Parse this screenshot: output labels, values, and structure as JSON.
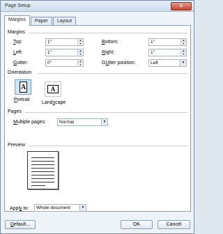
{
  "window": {
    "title": "Page Setup",
    "close_symbol": "✕"
  },
  "tabs": [
    {
      "label": "Margins",
      "active": true
    },
    {
      "label": "Paper",
      "active": false
    },
    {
      "label": "Layout",
      "active": false
    }
  ],
  "margins": {
    "section_label": "Margins",
    "top": {
      "label_ul": "T",
      "label_rest": "op:",
      "value": "1\""
    },
    "bottom": {
      "label_ul": "B",
      "label_rest": "ottom:",
      "value": "1\""
    },
    "left": {
      "label_ul": "L",
      "label_rest": "eft:",
      "value": "1\""
    },
    "right": {
      "label_ul": "R",
      "label_rest": "ight:",
      "value": "1\""
    },
    "gutter": {
      "label_ul": "G",
      "label_rest": "utter:",
      "value": "0\""
    },
    "gutter_position": {
      "label_ul": "U",
      "label_pre": "G",
      "label_rest": "tter position:",
      "value": "Left"
    }
  },
  "orientation": {
    "section_label": "Orientation",
    "portrait": {
      "label_ul": "P",
      "label_rest": "ortrait",
      "glyph": "A",
      "selected": true
    },
    "landscape": {
      "label_ul": "s",
      "label_pre": "Land",
      "label_rest": "cape",
      "glyph": "A",
      "selected": false
    }
  },
  "pages": {
    "section_label": "Pages",
    "multiple_pages": {
      "label_ul": "M",
      "label_rest": "ultiple pages:",
      "value": "Normal"
    }
  },
  "preview": {
    "section_label": "Preview"
  },
  "apply_to": {
    "label_pre": "Appl",
    "label_ul": "y",
    "label_rest": " to:",
    "value": "Whole document"
  },
  "buttons": {
    "default": {
      "label_ul": "D",
      "label_rest": "efault..."
    },
    "ok": "OK",
    "cancel": "Cancel"
  }
}
